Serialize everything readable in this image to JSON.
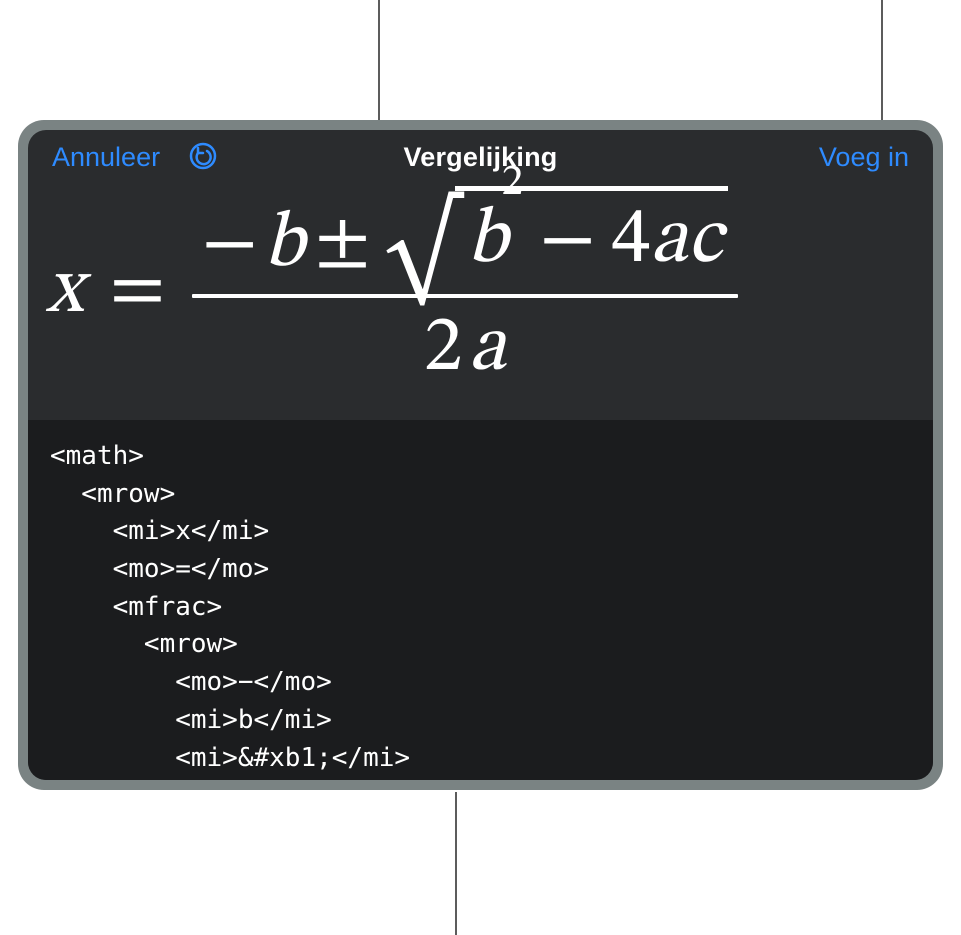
{
  "header": {
    "cancel_label": "Annuleer",
    "title": "Vergelijking",
    "insert_label": "Voeg in"
  },
  "equation": {
    "x": "x",
    "equals": "=",
    "minus": "−",
    "b": "b",
    "pm": "±",
    "surd": "√",
    "b2_base": "b",
    "b2_exp": "2",
    "minus2": "−",
    "four": "4",
    "a": "a",
    "c": "c",
    "two": "2",
    "a2": "a"
  },
  "code": "<math>\n  <mrow>\n    <mi>x</mi>\n    <mo>=</mo>\n    <mfrac>\n      <mrow>\n        <mo>−</mo>\n        <mi>b</mi>\n        <mi>&#xb1;</mi>"
}
